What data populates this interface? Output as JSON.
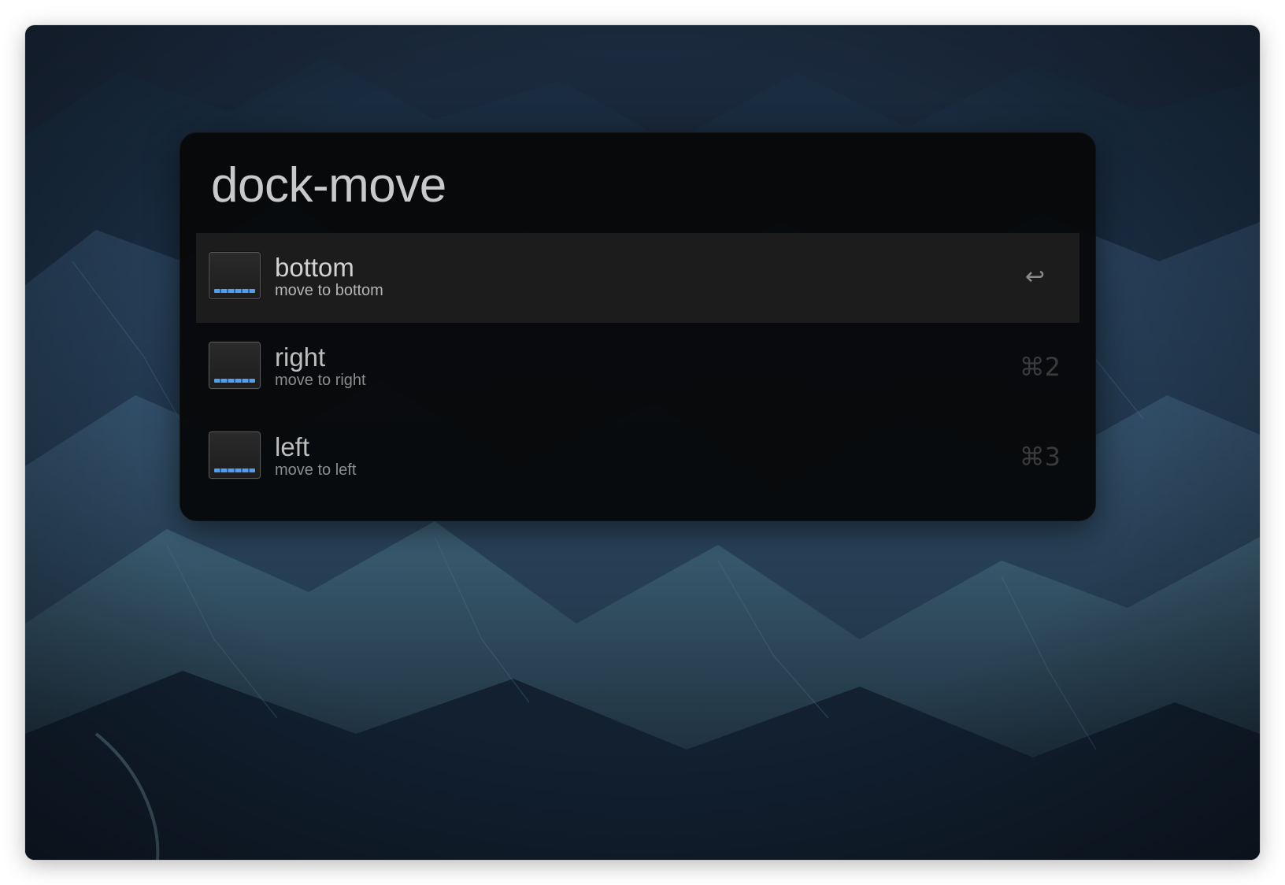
{
  "launcher": {
    "query": "dock-move"
  },
  "results": [
    {
      "title": "bottom",
      "subtitle": "move to bottom",
      "shortcut": "↩",
      "selected": true,
      "icon": "dock-icon"
    },
    {
      "title": "right",
      "subtitle": "move to right",
      "shortcut": "⌘2",
      "selected": false,
      "icon": "dock-icon"
    },
    {
      "title": "left",
      "subtitle": "move to left",
      "shortcut": "⌘3",
      "selected": false,
      "icon": "dock-icon"
    }
  ],
  "colors": {
    "launcher_bg": "#060709",
    "selected_row": "#1c1c1d",
    "dock_accent": "#4f9ef0"
  }
}
